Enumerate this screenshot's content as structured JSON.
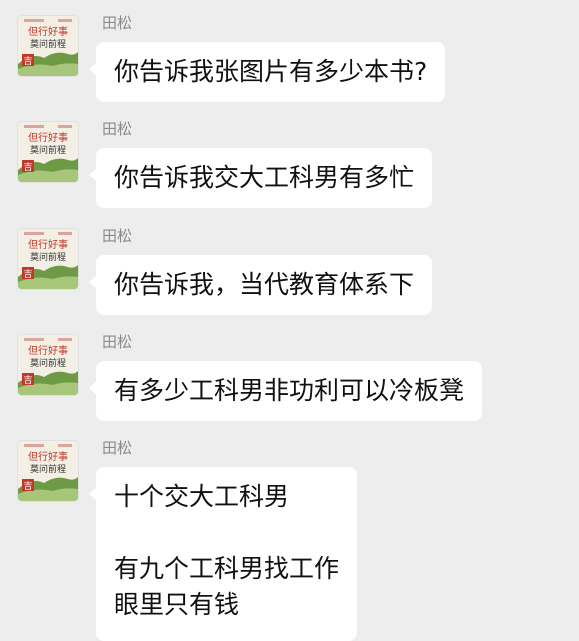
{
  "chat": {
    "avatar_text": {
      "line1": "但行好事",
      "line2": "莫问前程",
      "stamp": "吉"
    },
    "messages": [
      {
        "sender": "田松",
        "lines": [
          "你告诉我张图片有多少本书?"
        ]
      },
      {
        "sender": "田松",
        "lines": [
          "你告诉我交大工科男有多忙"
        ]
      },
      {
        "sender": "田松",
        "lines": [
          "你告诉我，当代教育体系下"
        ]
      },
      {
        "sender": "田松",
        "lines": [
          "有多少工科男非功利可以冷板凳"
        ]
      },
      {
        "sender": "田松",
        "lines": [
          "十个交大工科男",
          "",
          "有九个工科男找工作",
          "眼里只有钱"
        ]
      }
    ]
  },
  "colors": {
    "background": "#ededed",
    "bubble": "#ffffff",
    "sender_name": "#8a8a8a",
    "avatar_red": "#c0392b",
    "avatar_green": "#6f9a45"
  }
}
